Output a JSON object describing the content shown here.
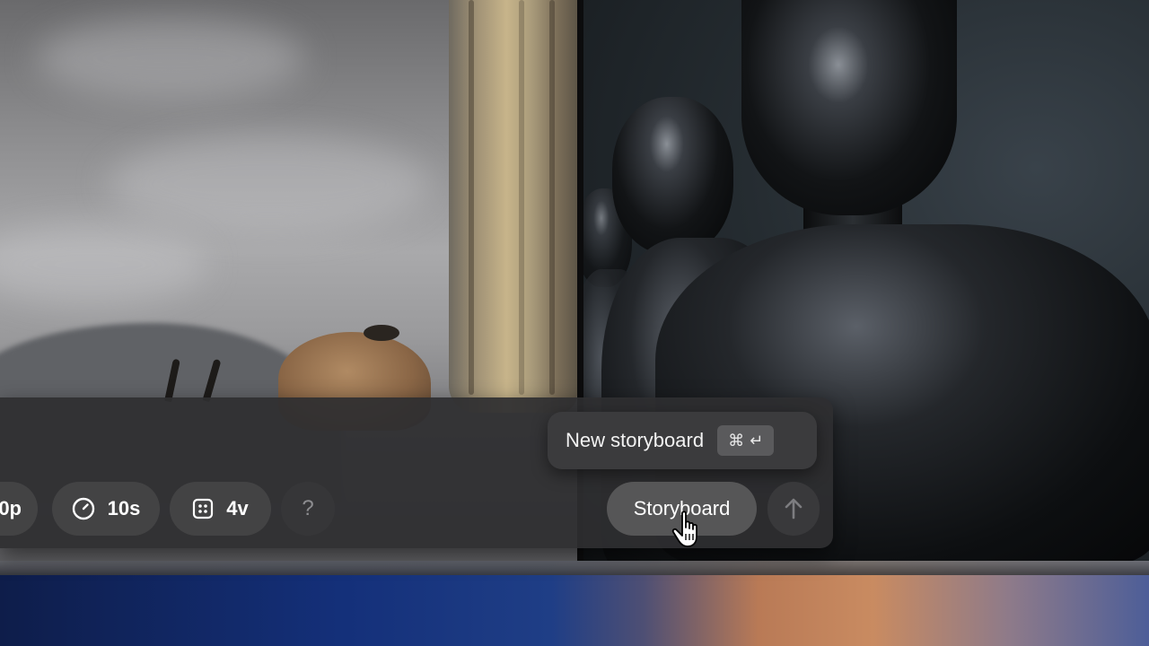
{
  "toolbar": {
    "quality_label": "0p",
    "duration_label": "10s",
    "variations_label": "4v",
    "help_label": "?",
    "storyboard_label": "Storyboard",
    "submit_icon": "arrow-up-icon"
  },
  "tooltip": {
    "label": "New storyboard",
    "shortcut_command": "⌘",
    "shortcut_return": "↵"
  },
  "icons": {
    "duration": "clock-icon",
    "variations": "grid-icon",
    "cursor": "hand-pointer-icon"
  },
  "colors": {
    "panel_background": "#2e2e30",
    "pill_background": "#444446",
    "text": "#ffffff",
    "muted_text": "#8d8d90"
  }
}
